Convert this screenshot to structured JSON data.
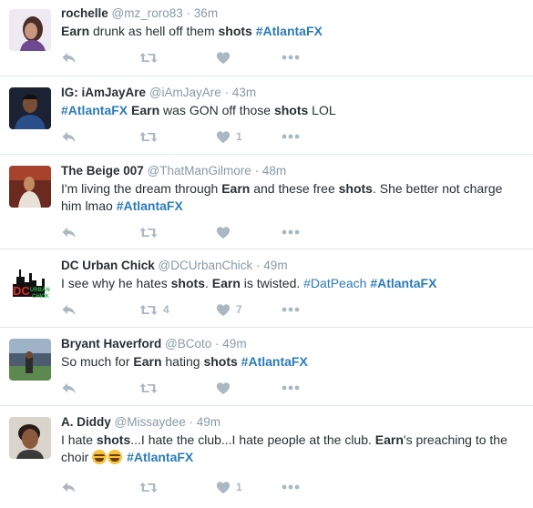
{
  "tweets": [
    {
      "name": "rochelle",
      "handle": "@mz_roro83",
      "time": "36m",
      "avatar": "avatar-woman",
      "retweets": "",
      "likes": ""
    },
    {
      "name": "IG: iAmJayAre",
      "handle": "@iAmJayAre",
      "time": "43m",
      "avatar": "avatar-man-dark",
      "retweets": "",
      "likes": "1"
    },
    {
      "name": "The Beige 007",
      "handle": "@ThatManGilmore",
      "time": "48m",
      "avatar": "avatar-man-red",
      "retweets": "",
      "likes": ""
    },
    {
      "name": "DC Urban Chick",
      "handle": "@DCUrbanChick",
      "time": "49m",
      "avatar": "avatar-dc-logo",
      "retweets": "4",
      "likes": "7"
    },
    {
      "name": "Bryant Haverford",
      "handle": "@BCoto",
      "time": "49m",
      "avatar": "avatar-stadium",
      "retweets": "",
      "likes": ""
    },
    {
      "name": "A. Diddy",
      "handle": "@Missaydee",
      "time": "49m",
      "avatar": "avatar-woman-2",
      "retweets": "",
      "likes": "1"
    }
  ],
  "text": {
    "t0": {
      "w1": "Earn",
      "w2": " drunk as hell off them ",
      "w3": "shots",
      "w4": "  ",
      "tag1": "#AtlantaFX"
    },
    "t1": {
      "tag1": "#AtlantaFX",
      "w1": " ",
      "w2": "Earn",
      "w3": " was GON off those ",
      "w4": "shots",
      "w5": " LOL"
    },
    "t2": {
      "w1": "I'm living the dream through ",
      "w2": "Earn",
      "w3": " and these free ",
      "w4": "shots",
      "w5": ". She better not charge him lmao ",
      "tag1": "#AtlantaFX"
    },
    "t3": {
      "w1": "I see why he hates ",
      "w2": "shots",
      "w3": ". ",
      "w4": "Earn",
      "w5": " is twisted.  ",
      "tag1": "#DatPeach",
      "w6": " ",
      "tag2": "#AtlantaFX"
    },
    "t4": {
      "w1": "So much for ",
      "w2": "Earn",
      "w3": " hating ",
      "w4": "shots",
      "w5": " ",
      "tag1": "#AtlantaFX"
    },
    "t5": {
      "w1": "I hate ",
      "w2": "shots",
      "w3": "...I hate the club...I hate people at the club.  ",
      "w4": "Earn",
      "w5": "'s preaching to the choir ",
      "w6": " ",
      "tag1": "#AtlantaFX"
    }
  },
  "icons": {
    "reply": "reply-icon",
    "retweet": "retweet-icon",
    "like": "heart-icon",
    "more": "more-icon",
    "emoji": "face-with-tears-of-joy-emoji"
  },
  "colors": {
    "hashtag": "#2b7bb9",
    "name": "#292f33",
    "muted": "#8899a6",
    "action": "#aab8c2",
    "divider": "#e1e8ed"
  }
}
